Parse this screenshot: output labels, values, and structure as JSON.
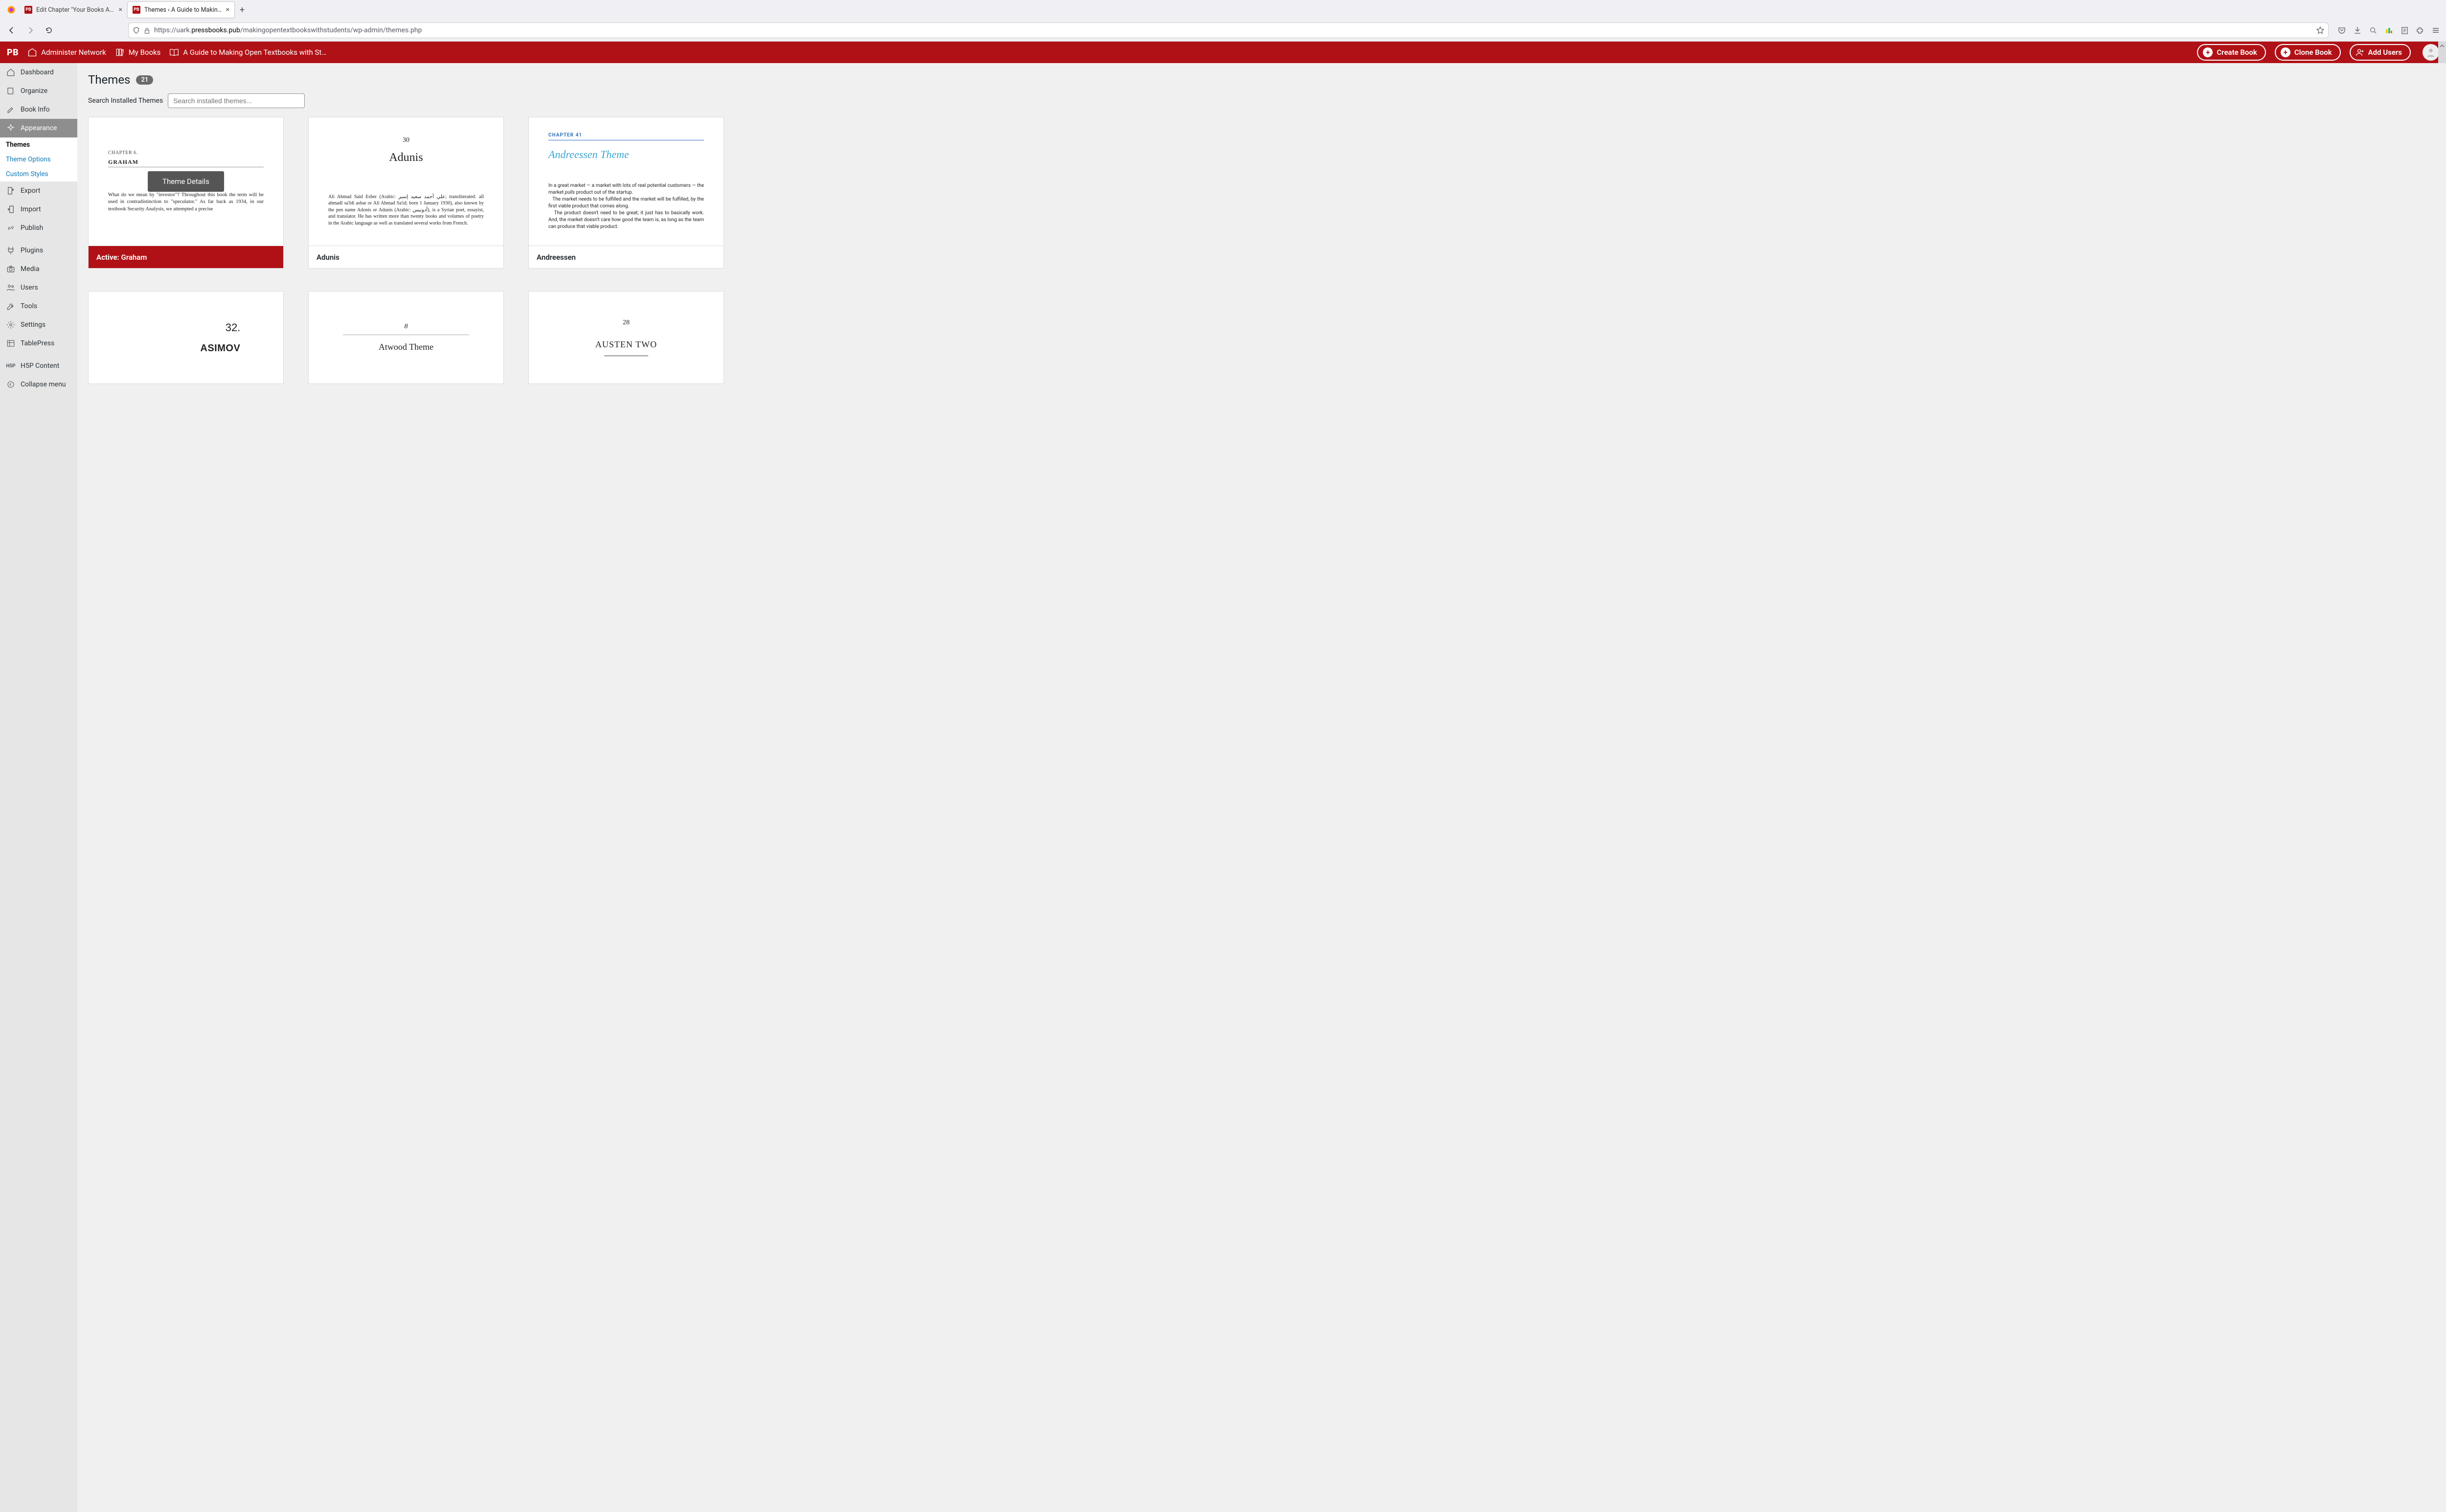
{
  "browser": {
    "tabs": [
      {
        "title": "Edit Chapter \"Your Books Appea",
        "active": false
      },
      {
        "title": "Themes ‹ A Guide to Making O",
        "active": true
      }
    ],
    "url_pre": "https://uark.",
    "url_host": "pressbooks.pub",
    "url_post": "/makingopentextbookswithstudents/wp-admin/themes.php"
  },
  "appbar": {
    "logo": "PB",
    "admin_net": "Administer Network",
    "my_books": "My Books",
    "book_title": "A Guide to Making Open Textbooks with St…",
    "create_book": "Create Book",
    "clone_book": "Clone Book",
    "add_users": "Add Users"
  },
  "sidebar": {
    "dashboard": "Dashboard",
    "organize": "Organize",
    "book_info": "Book Info",
    "appearance": "Appearance",
    "themes": "Themes",
    "theme_options": "Theme Options",
    "custom_styles": "Custom Styles",
    "export": "Export",
    "import": "Import",
    "publish": "Publish",
    "plugins": "Plugins",
    "media": "Media",
    "users": "Users",
    "tools": "Tools",
    "settings": "Settings",
    "tablepress": "TablePress",
    "h5p": "H5P Content",
    "collapse": "Collapse menu"
  },
  "page": {
    "title": "Themes",
    "count": "21",
    "search_label": "Search Installed Themes",
    "search_placeholder": "Search installed themes...",
    "theme_details": "Theme Details",
    "active_prefix": "Active:"
  },
  "themes": {
    "graham": {
      "name": "Graham",
      "pv_ch": "CHAPTER 6.",
      "pv_title": "GRAHAM",
      "pv_body": "What do we mean by \"investor\"? Throughout this book the term will be used in contradistinction to \"speculator.\" As far back as 1934, in our textbook Security Analysis, we attempted a precise"
    },
    "adunis": {
      "name": "Adunis",
      "pv_num": "30",
      "pv_title": "Adunis",
      "pv_body": "Ali Ahmad Said Esber (Arabic: علي أحمد سعيد إسبر; transliterated: alī ahmadī sa'īdi asbar or Ali Ahmad Sa'id; born 1 January 1930), also known by the pen name Adonis or Adunis (Arabic: أدونيس), is a Syrian poet, essayist, and translator. He has written more than twenty books and volumes of poetry in the Arabic language as well as translated several works from French."
    },
    "andreessen": {
      "name": "Andreessen",
      "pv_ch": "CHAPTER 41",
      "pv_title": "Andreessen Theme",
      "pv_body1": "In a great market — a market with lots of real potential customers — the market ",
      "pv_body1_i": "pulls",
      "pv_body1_b": " product out of the startup.",
      "pv_body2": "The market needs to be fulfilled and the market will be fulfilled, by the first viable product that comes along.",
      "pv_body3": "The product doesn't need to be great; it just has to basically work. And, the market doesn't care how good the team is, as long as the team can produce that viable product."
    },
    "asimov": {
      "name": "Asimov",
      "pv_num": "32.",
      "pv_title": "ASIMOV"
    },
    "atwood": {
      "name": "Atwood",
      "pv_num": "8",
      "pv_title": "Atwood Theme"
    },
    "austen": {
      "name": "Austen Two",
      "pv_num": "28",
      "pv_title": "AUSTEN TWO"
    }
  }
}
